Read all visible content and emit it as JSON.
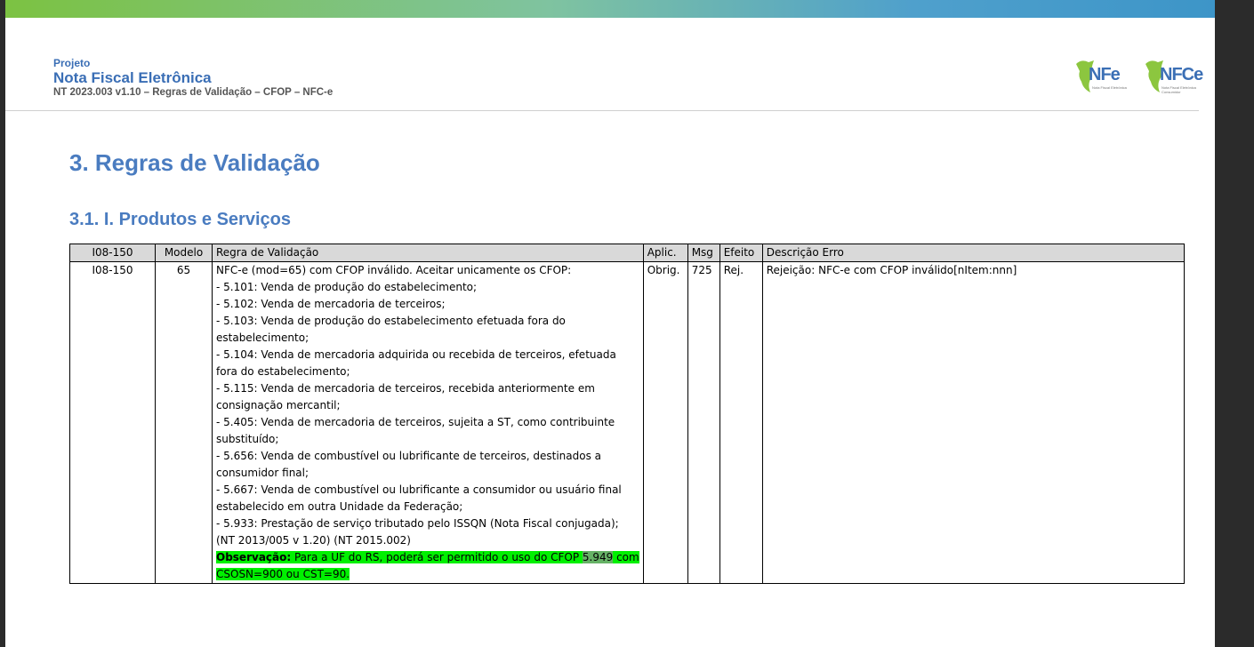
{
  "header": {
    "projeto": "Projeto",
    "title": "Nota Fiscal Eletrônica",
    "subtitle": "NT 2023.003 v1.10 – Regras de Validação – CFOP – NFC-e"
  },
  "logos": [
    {
      "text": "NFe",
      "tag": "Nota Fiscal Eletrônica"
    },
    {
      "text": "NFCe",
      "tag": "Nota Fiscal Eletrônica Consumidor"
    }
  ],
  "section": {
    "title": "3. Regras de Validação",
    "subtitle": "3.1. I. Produtos e Serviços"
  },
  "table": {
    "headers": [
      "I08-150",
      "Modelo",
      "Regra de Validação",
      "Aplic.",
      "Msg",
      "Efeito",
      "Descrição Erro"
    ],
    "row": {
      "id": "I08-150",
      "modelo": "65",
      "aplic": "Obrig.",
      "msg": "725",
      "efeito": "Rej.",
      "descricao": "Rejeição: NFC-e com CFOP inválido[nItem:nnn]",
      "rule_lines": [
        "NFC-e (mod=65) com CFOP inválido. Aceitar unicamente os CFOP:",
        " - 5.101: Venda de produção do estabelecimento;",
        " - 5.102: Venda de mercadoria de terceiros;",
        " - 5.103: Venda de produção do estabelecimento efetuada fora do",
        "estabelecimento;",
        " - 5.104: Venda de mercadoria adquirida ou recebida de terceiros, efetuada",
        "fora do estabelecimento;",
        " - 5.115: Venda de mercadoria de terceiros, recebida anteriormente em",
        "consignação mercantil;",
        " - 5.405: Venda de mercadoria de terceiros, sujeita a ST, como contribuinte",
        "substituído;",
        " - 5.656: Venda de combustível ou lubrificante de terceiros, destinados a",
        "consumidor final;",
        " - 5.667: Venda de combustível ou lubrificante a consumidor ou usuário final",
        "estabelecido em outra Unidade da Federação;",
        " - 5.933: Prestação de serviço tributado pelo ISSQN (Nota Fiscal conjugada);",
        "(NT 2013/005 v 1.20) (NT 2015.002)"
      ],
      "obs_label": "Observação:",
      "obs_text_1": " Para a UF do RS, poderá ser permitido o uso do CFOP ",
      "obs_cfop": "5.949",
      "obs_text_2": " com",
      "obs_text_3": "CSOSN=900 ou CST=90."
    }
  },
  "colors": {
    "heading": "#4a7cc0",
    "highlight": "#00f000",
    "header_bg": "#d9d9d9"
  }
}
